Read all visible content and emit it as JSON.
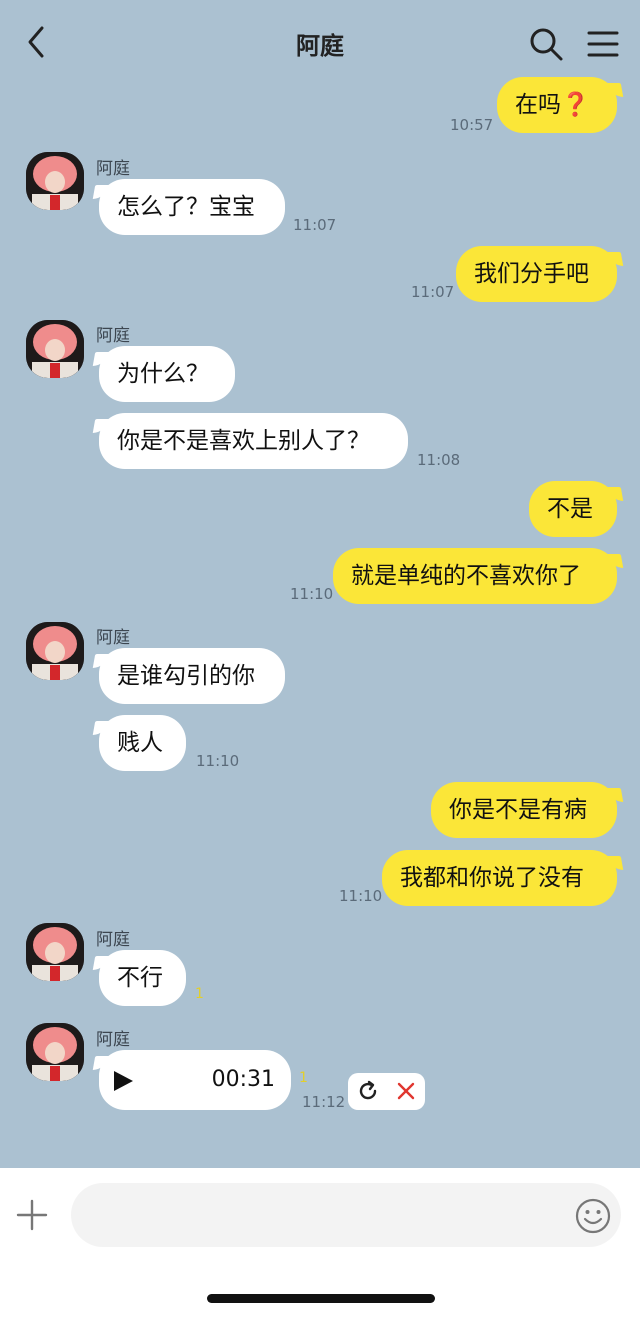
{
  "header": {
    "title": "阿庭"
  },
  "contact": {
    "name": "阿庭"
  },
  "messages": {
    "m1": {
      "text": "在吗",
      "emoji": "❓",
      "time": "10:57"
    },
    "m2": {
      "text": "怎么了？宝宝",
      "time": "11:07"
    },
    "m3": {
      "text": "我们分手吧",
      "time": "11:07"
    },
    "m4": {
      "text": "为什么？"
    },
    "m5": {
      "text": "你是不是喜欢上别人了？",
      "time": "11:08"
    },
    "m6": {
      "text": "不是"
    },
    "m7": {
      "text": "就是单纯的不喜欢你了",
      "time": "11:10"
    },
    "m8": {
      "text": "是谁勾引的你"
    },
    "m9": {
      "text": "贱人",
      "time": "11:10"
    },
    "m10": {
      "text": "你是不是有病"
    },
    "m11": {
      "text": "我都和你说了没有",
      "time": "11:10"
    },
    "m12": {
      "text": "不行",
      "unread": "1"
    },
    "voice": {
      "duration": "00:31",
      "unread": "1",
      "time": "11:12"
    }
  },
  "input": {
    "placeholder": ""
  },
  "colors": {
    "background": "#abc1d1",
    "outgoing": "#fbe638",
    "incoming": "#ffffff"
  },
  "icons": [
    "back-icon",
    "search-icon",
    "menu-icon",
    "play-icon",
    "retry-icon",
    "cancel-icon",
    "plus-icon",
    "emoji-icon"
  ]
}
